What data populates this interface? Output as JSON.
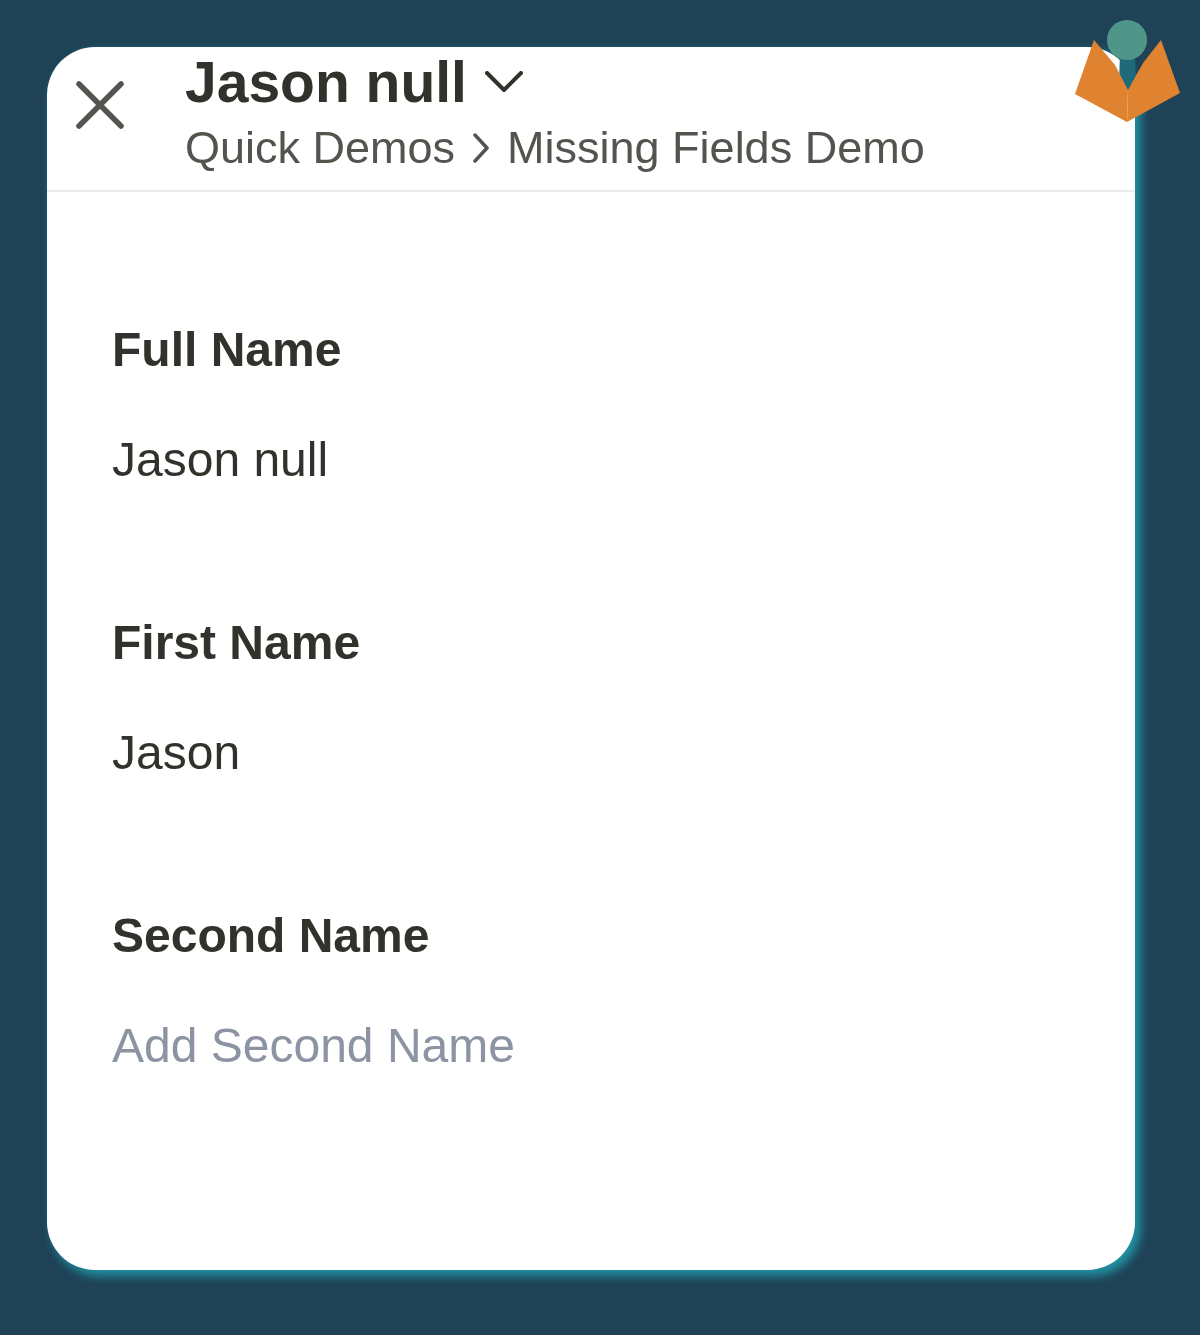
{
  "header": {
    "title": "Jason null",
    "breadcrumb": [
      "Quick Demos",
      "Missing Fields Demo"
    ]
  },
  "fields": [
    {
      "label": "Full Name",
      "value": "Jason null"
    },
    {
      "label": "First Name",
      "value": "Jason"
    },
    {
      "label": "Second Name",
      "placeholder": "Add Second Name"
    }
  ]
}
